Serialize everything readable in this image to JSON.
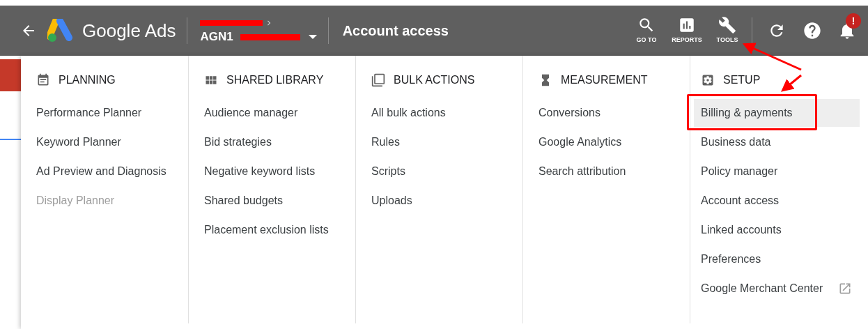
{
  "topbar": {
    "brand": "Google Ads",
    "account_id": "AGN1",
    "page_title": "Account access",
    "tools": [
      {
        "kind": "search",
        "label": "GO TO"
      },
      {
        "kind": "reports",
        "label": "REPORTS"
      },
      {
        "kind": "tools",
        "label": "TOOLS"
      }
    ],
    "notification_badge": "!"
  },
  "menu": {
    "sections": [
      {
        "kind": "planning",
        "title": "PLANNING",
        "items": [
          {
            "label": "Performance Planner",
            "disabled": false,
            "selected": false,
            "highlighted": false,
            "external": false
          },
          {
            "label": "Keyword Planner",
            "disabled": false,
            "selected": false,
            "highlighted": false,
            "external": false
          },
          {
            "label": "Ad Preview and Diagnosis",
            "disabled": false,
            "selected": false,
            "highlighted": false,
            "external": false
          },
          {
            "label": "Display Planner",
            "disabled": true,
            "selected": false,
            "highlighted": false,
            "external": false
          }
        ]
      },
      {
        "kind": "library",
        "title": "SHARED LIBRARY",
        "items": [
          {
            "label": "Audience manager",
            "disabled": false,
            "selected": false,
            "highlighted": false,
            "external": false
          },
          {
            "label": "Bid strategies",
            "disabled": false,
            "selected": false,
            "highlighted": false,
            "external": false
          },
          {
            "label": "Negative keyword lists",
            "disabled": false,
            "selected": false,
            "highlighted": false,
            "external": false
          },
          {
            "label": "Shared budgets",
            "disabled": false,
            "selected": false,
            "highlighted": false,
            "external": false
          },
          {
            "label": "Placement exclusion lists",
            "disabled": false,
            "selected": false,
            "highlighted": false,
            "external": false
          }
        ]
      },
      {
        "kind": "bulk",
        "title": "BULK ACTIONS",
        "items": [
          {
            "label": "All bulk actions",
            "disabled": false,
            "selected": false,
            "highlighted": false,
            "external": false
          },
          {
            "label": "Rules",
            "disabled": false,
            "selected": false,
            "highlighted": false,
            "external": false
          },
          {
            "label": "Scripts",
            "disabled": false,
            "selected": false,
            "highlighted": false,
            "external": false
          },
          {
            "label": "Uploads",
            "disabled": false,
            "selected": false,
            "highlighted": false,
            "external": false
          }
        ]
      },
      {
        "kind": "measurement",
        "title": "MEASUREMENT",
        "items": [
          {
            "label": "Conversions",
            "disabled": false,
            "selected": false,
            "highlighted": false,
            "external": false
          },
          {
            "label": "Google Analytics",
            "disabled": false,
            "selected": false,
            "highlighted": false,
            "external": false
          },
          {
            "label": "Search attribution",
            "disabled": false,
            "selected": false,
            "highlighted": false,
            "external": false
          }
        ]
      },
      {
        "kind": "setup",
        "title": "SETUP",
        "items": [
          {
            "label": "Billing & payments",
            "disabled": false,
            "selected": true,
            "highlighted": true,
            "external": false
          },
          {
            "label": "Business data",
            "disabled": false,
            "selected": false,
            "highlighted": false,
            "external": false
          },
          {
            "label": "Policy manager",
            "disabled": false,
            "selected": false,
            "highlighted": false,
            "external": false
          },
          {
            "label": "Account access",
            "disabled": false,
            "selected": false,
            "highlighted": false,
            "external": false
          },
          {
            "label": "Linked accounts",
            "disabled": false,
            "selected": false,
            "highlighted": false,
            "external": false
          },
          {
            "label": "Preferences",
            "disabled": false,
            "selected": false,
            "highlighted": false,
            "external": false
          },
          {
            "label": "Google Merchant Center",
            "disabled": false,
            "selected": false,
            "highlighted": false,
            "external": true
          }
        ]
      }
    ]
  }
}
